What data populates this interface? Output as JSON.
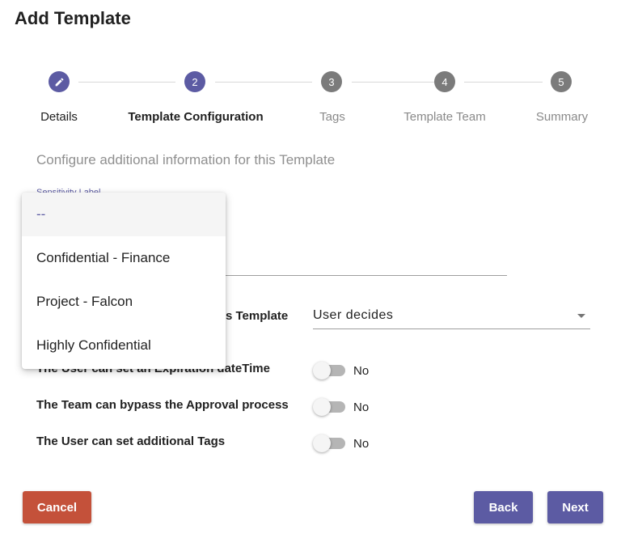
{
  "dialog": {
    "title": "Add Template"
  },
  "stepper": {
    "steps": [
      {
        "number": "",
        "label": "Details",
        "state": "done",
        "icon": "pencil-icon"
      },
      {
        "number": "2",
        "label": "Template Configuration",
        "state": "current"
      },
      {
        "number": "3",
        "label": "Tags",
        "state": "pending"
      },
      {
        "number": "4",
        "label": "Template Team",
        "state": "pending"
      },
      {
        "number": "5",
        "label": "Summary",
        "state": "pending"
      }
    ]
  },
  "form": {
    "subtitle": "Configure additional information for this Template",
    "sensitivity_label": {
      "label": "Sensitivity Label",
      "options": [
        "--",
        "Confidential - Finance",
        "Project - Falcon",
        "Highly Confidential"
      ],
      "highlighted": "--"
    },
    "classification": {
      "label_visible": "s Template",
      "value": "User decides"
    },
    "toggles": [
      {
        "label": "The User can set an Expiration dateTime",
        "value": "No",
        "on": false
      },
      {
        "label": "The Team can bypass the Approval process",
        "value": "No",
        "on": false
      },
      {
        "label": "The User can set additional Tags",
        "value": "No",
        "on": false
      }
    ]
  },
  "actions": {
    "cancel": "Cancel",
    "back": "Back",
    "next": "Next"
  },
  "colors": {
    "primary": "#5c5ba3",
    "danger": "#c4513a",
    "inactive_step": "#7b7b7b"
  }
}
